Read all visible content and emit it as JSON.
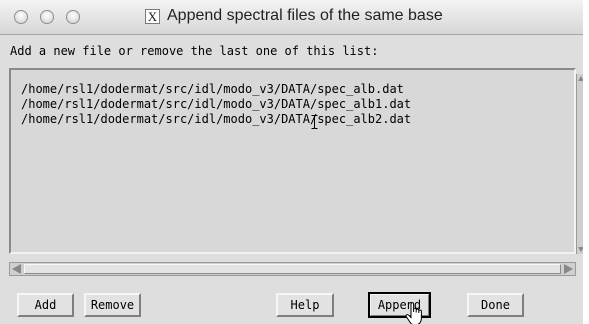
{
  "window": {
    "title": "Append spectral files of the same base",
    "x11_icon": "X"
  },
  "instruction": "Add a new file or remove the last one of this list:",
  "list": {
    "items": [
      "/home/rsl1/dodermat/src/idl/modo_v3/DATA/spec_alb.dat",
      "/home/rsl1/dodermat/src/idl/modo_v3/DATA/spec_alb1.dat",
      "/home/rsl1/dodermat/src/idl/modo_v3/DATA/spec_alb2.dat"
    ]
  },
  "buttons": {
    "add": "Add",
    "remove": "Remove",
    "help": "Help",
    "append": "Append",
    "done": "Done"
  },
  "icons": {
    "traffic_lights": [
      "close-icon",
      "minimize-icon",
      "zoom-icon"
    ],
    "x11": "x11-app-icon",
    "text_cursor": "ibeam-cursor-icon",
    "pointer": "hand-pointer-icon"
  }
}
